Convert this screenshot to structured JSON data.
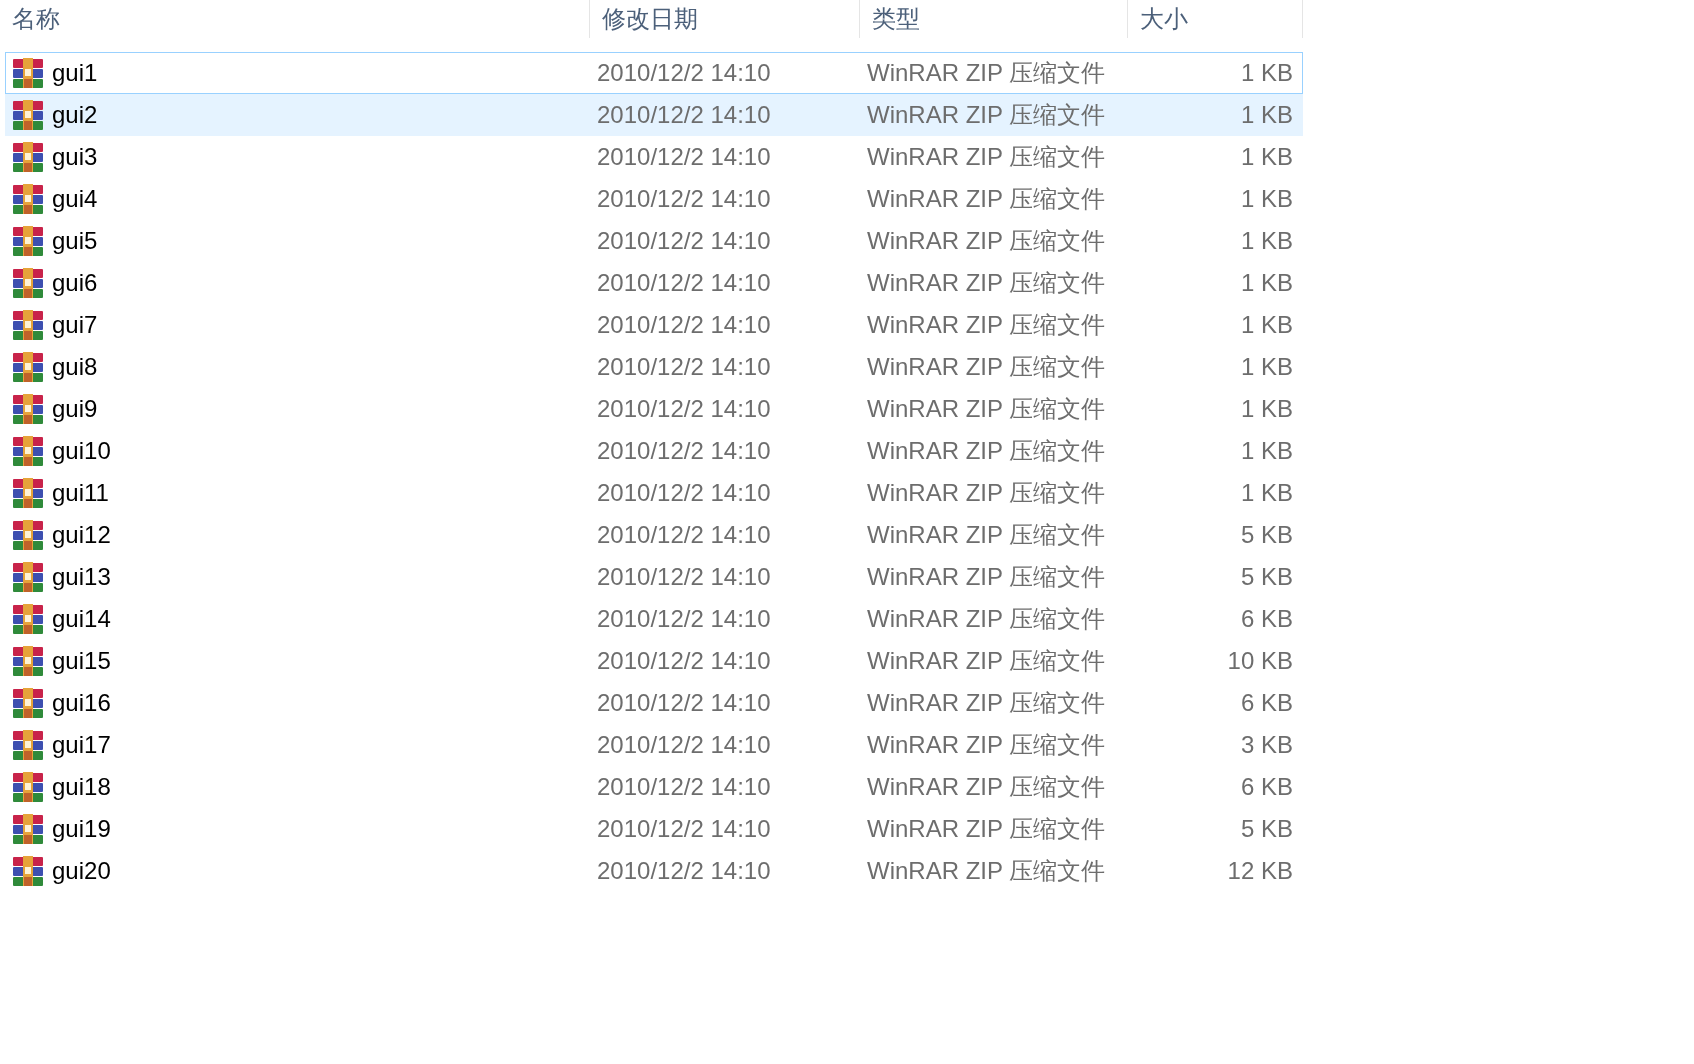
{
  "columns": [
    "名称",
    "修改日期",
    "类型",
    "大小"
  ],
  "rows": [
    {
      "name": "gui1",
      "modified": "2010/12/2 14:10",
      "type": "WinRAR ZIP 压缩文件",
      "size": "1 KB",
      "selected": false,
      "focused": true
    },
    {
      "name": "gui2",
      "modified": "2010/12/2 14:10",
      "type": "WinRAR ZIP 压缩文件",
      "size": "1 KB",
      "selected": true,
      "focused": false
    },
    {
      "name": "gui3",
      "modified": "2010/12/2 14:10",
      "type": "WinRAR ZIP 压缩文件",
      "size": "1 KB",
      "selected": false,
      "focused": false
    },
    {
      "name": "gui4",
      "modified": "2010/12/2 14:10",
      "type": "WinRAR ZIP 压缩文件",
      "size": "1 KB",
      "selected": false,
      "focused": false
    },
    {
      "name": "gui5",
      "modified": "2010/12/2 14:10",
      "type": "WinRAR ZIP 压缩文件",
      "size": "1 KB",
      "selected": false,
      "focused": false
    },
    {
      "name": "gui6",
      "modified": "2010/12/2 14:10",
      "type": "WinRAR ZIP 压缩文件",
      "size": "1 KB",
      "selected": false,
      "focused": false
    },
    {
      "name": "gui7",
      "modified": "2010/12/2 14:10",
      "type": "WinRAR ZIP 压缩文件",
      "size": "1 KB",
      "selected": false,
      "focused": false
    },
    {
      "name": "gui8",
      "modified": "2010/12/2 14:10",
      "type": "WinRAR ZIP 压缩文件",
      "size": "1 KB",
      "selected": false,
      "focused": false
    },
    {
      "name": "gui9",
      "modified": "2010/12/2 14:10",
      "type": "WinRAR ZIP 压缩文件",
      "size": "1 KB",
      "selected": false,
      "focused": false
    },
    {
      "name": "gui10",
      "modified": "2010/12/2 14:10",
      "type": "WinRAR ZIP 压缩文件",
      "size": "1 KB",
      "selected": false,
      "focused": false
    },
    {
      "name": "gui11",
      "modified": "2010/12/2 14:10",
      "type": "WinRAR ZIP 压缩文件",
      "size": "1 KB",
      "selected": false,
      "focused": false
    },
    {
      "name": "gui12",
      "modified": "2010/12/2 14:10",
      "type": "WinRAR ZIP 压缩文件",
      "size": "5 KB",
      "selected": false,
      "focused": false
    },
    {
      "name": "gui13",
      "modified": "2010/12/2 14:10",
      "type": "WinRAR ZIP 压缩文件",
      "size": "5 KB",
      "selected": false,
      "focused": false
    },
    {
      "name": "gui14",
      "modified": "2010/12/2 14:10",
      "type": "WinRAR ZIP 压缩文件",
      "size": "6 KB",
      "selected": false,
      "focused": false
    },
    {
      "name": "gui15",
      "modified": "2010/12/2 14:10",
      "type": "WinRAR ZIP 压缩文件",
      "size": "10 KB",
      "selected": false,
      "focused": false
    },
    {
      "name": "gui16",
      "modified": "2010/12/2 14:10",
      "type": "WinRAR ZIP 压缩文件",
      "size": "6 KB",
      "selected": false,
      "focused": false
    },
    {
      "name": "gui17",
      "modified": "2010/12/2 14:10",
      "type": "WinRAR ZIP 压缩文件",
      "size": "3 KB",
      "selected": false,
      "focused": false
    },
    {
      "name": "gui18",
      "modified": "2010/12/2 14:10",
      "type": "WinRAR ZIP 压缩文件",
      "size": "6 KB",
      "selected": false,
      "focused": false
    },
    {
      "name": "gui19",
      "modified": "2010/12/2 14:10",
      "type": "WinRAR ZIP 压缩文件",
      "size": "5 KB",
      "selected": false,
      "focused": false
    },
    {
      "name": "gui20",
      "modified": "2010/12/2 14:10",
      "type": "WinRAR ZIP 压缩文件",
      "size": "12 KB",
      "selected": false,
      "focused": false
    }
  ]
}
